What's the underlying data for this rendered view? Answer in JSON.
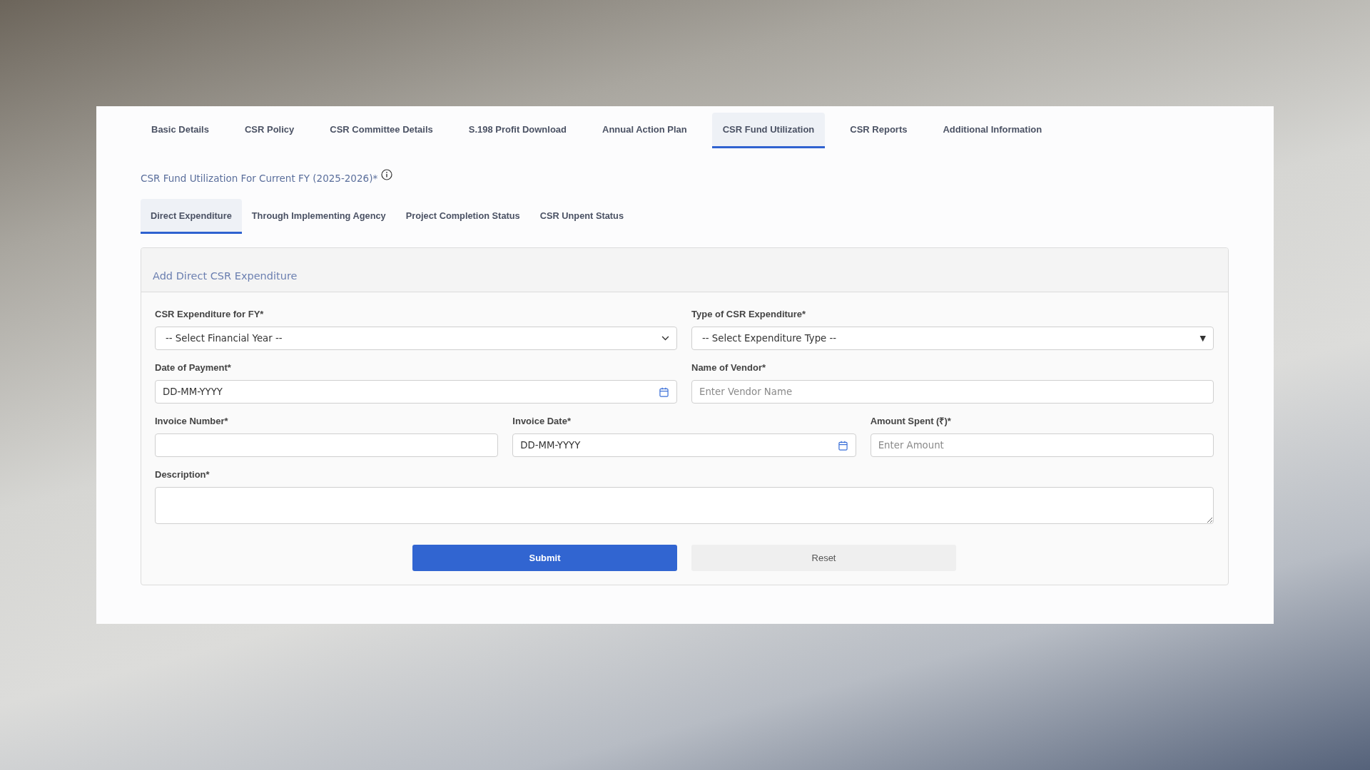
{
  "tabs": [
    {
      "label": "Basic Details",
      "selected": false
    },
    {
      "label": "CSR Policy",
      "selected": false
    },
    {
      "label": "CSR Committee Details",
      "selected": false
    },
    {
      "label": "S.198 Profit Download",
      "selected": false
    },
    {
      "label": "Annual Action Plan",
      "selected": false
    },
    {
      "label": "CSR Fund Utilization",
      "selected": true
    },
    {
      "label": "CSR Reports",
      "selected": false
    },
    {
      "label": "Additional Information",
      "selected": false
    }
  ],
  "section": {
    "title": "CSR Fund Utilization For Current FY (2025-2026)*"
  },
  "sub_tabs": [
    {
      "label": "Direct Expenditure",
      "selected": true
    },
    {
      "label": "Through Implementing Agency",
      "selected": false
    },
    {
      "label": "Project Completion Status",
      "selected": false
    },
    {
      "label": "CSR Unpent Status",
      "selected": false
    }
  ],
  "form": {
    "title": "Add Direct CSR Expenditure",
    "rows": [
      {
        "fields": [
          {
            "label": "CSR Expenditure for FY*",
            "kind": "select",
            "value": "-- Select Financial Year --"
          },
          {
            "label": "Type of CSR Expenditure*",
            "kind": "select",
            "value": "-- Select Expenditure Type --",
            "arrow": "▼"
          }
        ]
      },
      {
        "fields": [
          {
            "label": "Date of Payment*",
            "kind": "date",
            "placeholder": "DD-MM-YYYY"
          },
          {
            "label": "Name of Vendor*",
            "kind": "text",
            "placeholder": "Enter Vendor Name"
          }
        ]
      },
      {
        "fields": [
          {
            "label": "Invoice Number*",
            "kind": "text"
          },
          {
            "label": "Invoice Date*",
            "kind": "date",
            "placeholder": "DD-MM-YYYY"
          },
          {
            "label": "Amount Spent (₹)*",
            "kind": "text",
            "placeholder": "Enter Amount"
          }
        ]
      },
      {
        "fields": [
          {
            "label": "Description*",
            "kind": "textarea"
          }
        ]
      }
    ],
    "buttons": [
      {
        "label": "Submit",
        "kind": "primary"
      },
      {
        "label": "Reset",
        "kind": "secondary"
      }
    ]
  }
}
